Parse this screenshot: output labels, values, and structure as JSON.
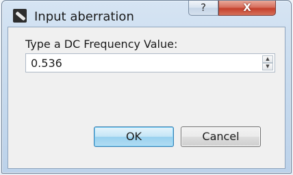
{
  "window": {
    "title": "Input aberration",
    "help_glyph": "?",
    "close_glyph": "X"
  },
  "form": {
    "prompt": "Type a DC Frequency Value:",
    "value": "0.536",
    "spin_up_glyph": "▲",
    "spin_down_glyph": "▼"
  },
  "buttons": {
    "ok_label": "OK",
    "cancel_label": "Cancel"
  },
  "icons": {
    "app": "app-icon",
    "help": "help-icon",
    "close": "close-icon",
    "spin_up": "spin-up-icon",
    "spin_down": "spin-down-icon"
  },
  "colors": {
    "close_button": "#c4402c",
    "default_button_border": "#3c7fb1",
    "title_frame": "#c9dcef"
  }
}
